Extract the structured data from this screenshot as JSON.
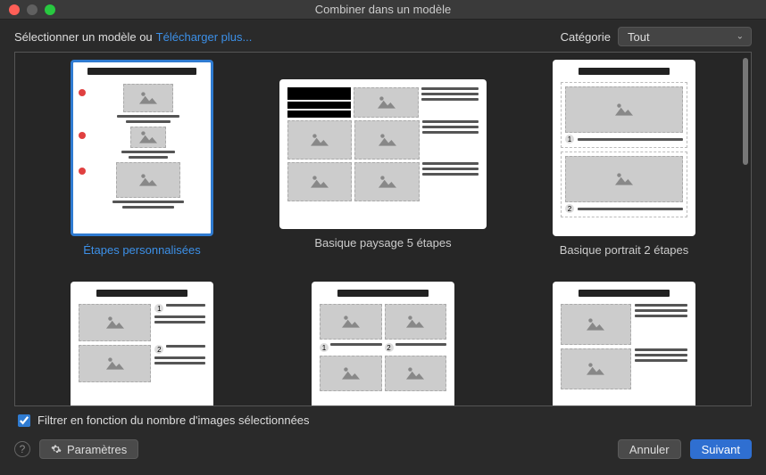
{
  "window": {
    "title": "Combiner dans un modèle"
  },
  "header": {
    "select_label": "Sélectionner un modèle ou",
    "download_link": "Télécharger plus...",
    "category_label": "Catégorie",
    "category_value": "Tout"
  },
  "templates": [
    {
      "name": "Étapes personnalisées",
      "selected": true,
      "orientation": "portrait"
    },
    {
      "name": "Basique paysage 5 étapes",
      "selected": false,
      "orientation": "landscape"
    },
    {
      "name": "Basique portrait 2 étapes",
      "selected": false,
      "orientation": "portrait"
    },
    {
      "name": "",
      "selected": false,
      "orientation": "portrait"
    },
    {
      "name": "",
      "selected": false,
      "orientation": "portrait"
    },
    {
      "name": "",
      "selected": false,
      "orientation": "portrait"
    }
  ],
  "filter": {
    "checked": true,
    "label": "Filtrer en fonction du nombre d'images sélectionnées"
  },
  "buttons": {
    "params": "Paramètres",
    "cancel": "Annuler",
    "next": "Suivant"
  }
}
